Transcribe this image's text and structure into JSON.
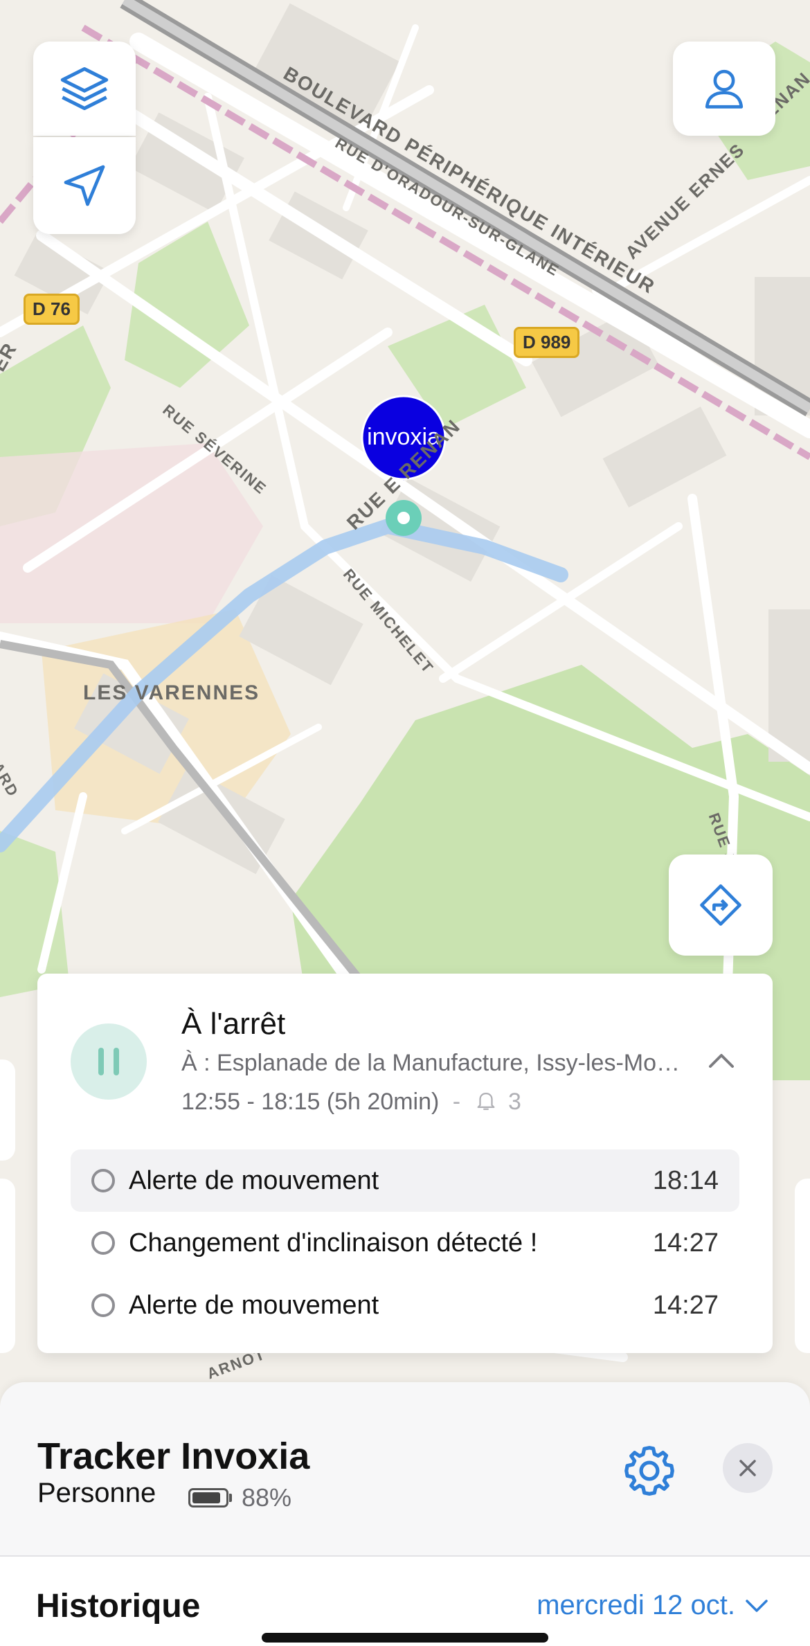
{
  "map": {
    "labels": {
      "boulevard": "BOULEVARD PÉRIPHÉRIQUE INTÉRIEUR",
      "oradour": "RUE D'ORADOUR-SUR-GLANE",
      "ernest": "AVENUE ERNES",
      "renan": "RUE E    RENAN",
      "severine": "RUE SÉVERINE",
      "michelet": "RUE MICHELET",
      "varennes": "LES VARENNES",
      "carnot": "ARNOT",
      "jules": "RUE JU",
      "ard": "ARD",
      "er": "ER",
      "enan": "ENAN"
    },
    "shields": {
      "d76": "D 76",
      "d989": "D 989"
    },
    "marker_text": "invoxia",
    "colors": {
      "marker": "#0a00e0",
      "accent": "#2f7fd8",
      "route": "#a9cbf0",
      "park": "#cfe6b8"
    }
  },
  "buttons": {
    "layers_icon": "layers-icon",
    "locate_icon": "location-arrow-icon",
    "profile_icon": "user-icon",
    "directions_icon": "directions-icon"
  },
  "stop_card": {
    "title": "À l'arrêt",
    "destination": "À : Esplanade de la Manufacture, Issy-les-Moulineaux",
    "time_range": "12:55 - 18:15 (5h 20min)",
    "separator": "-",
    "alert_count": "3",
    "alerts": [
      {
        "label": "Alerte de mouvement",
        "time": "18:14"
      },
      {
        "label": "Changement d'inclinaison détecté !",
        "time": "14:27"
      },
      {
        "label": "Alerte de mouvement",
        "time": "14:27"
      }
    ]
  },
  "sheet": {
    "name": "Tracker Invoxia",
    "type": "Personne",
    "battery_pct": "88%",
    "battery_level": 0.88,
    "history_title": "Historique",
    "history_date": "mercredi 12 oct."
  }
}
